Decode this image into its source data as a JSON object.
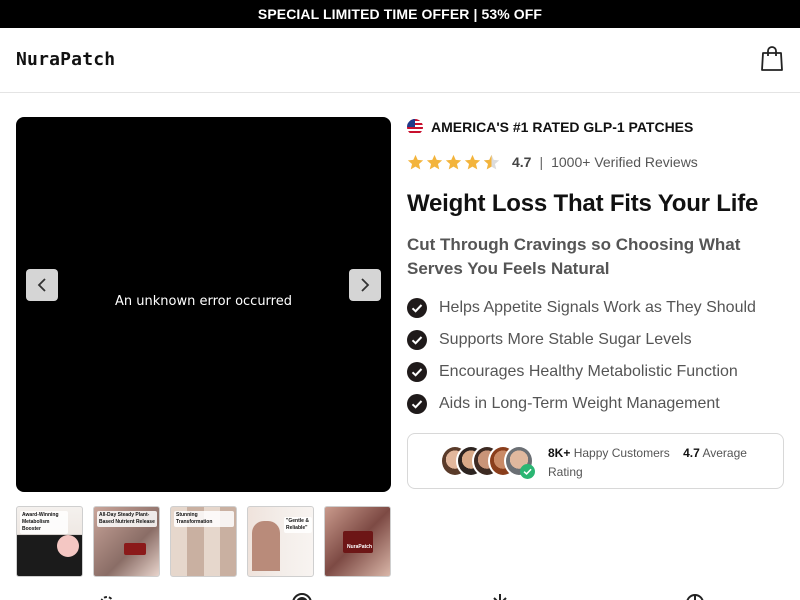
{
  "announcement": "SPECIAL LIMITED TIME OFFER | 53% OFF",
  "brand": {
    "logo": "NuraPatch"
  },
  "header": {
    "cart_icon": "shopping-bag-icon"
  },
  "media": {
    "error_text": "An unknown error occurred",
    "prev_icon": "chevron-left-icon",
    "next_icon": "chevron-right-icon",
    "thumbnails": [
      {
        "caption": "Award-Winning Metabolism Booster"
      },
      {
        "caption": "All-Day Steady Plant-Based Nutrient Release"
      },
      {
        "caption": "Stunning Transformation"
      },
      {
        "caption": "\"Gentle & Reliable\""
      },
      {
        "caption": "NuraPatch"
      }
    ]
  },
  "product": {
    "badge": "AMERICA'S #1 RATED GLP-1 PATCHES",
    "rating_value": "4.7",
    "rating_stars": 4.5,
    "reviews": "1000+ Verified Reviews",
    "title": "Weight Loss That Fits Your Life",
    "subtitle": "Cut Through Cravings so Choosing What Serves You Feels Natural",
    "benefits": [
      "Helps Appetite Signals Work as They Should",
      "Supports More Stable Sugar Levels",
      "Encourages Healthy Metabolistic Function",
      "Aids in Long-Term Weight Management"
    ]
  },
  "social_proof": {
    "customers_count": "8K+",
    "customers_label": "Happy Customers",
    "rating": "4.7",
    "rating_label": "Average Rating"
  },
  "colors": {
    "announcement_bg": "#000000",
    "accent": "#f3b43c",
    "check_bg": "#1f1a1a",
    "verified": "#2bb673"
  }
}
